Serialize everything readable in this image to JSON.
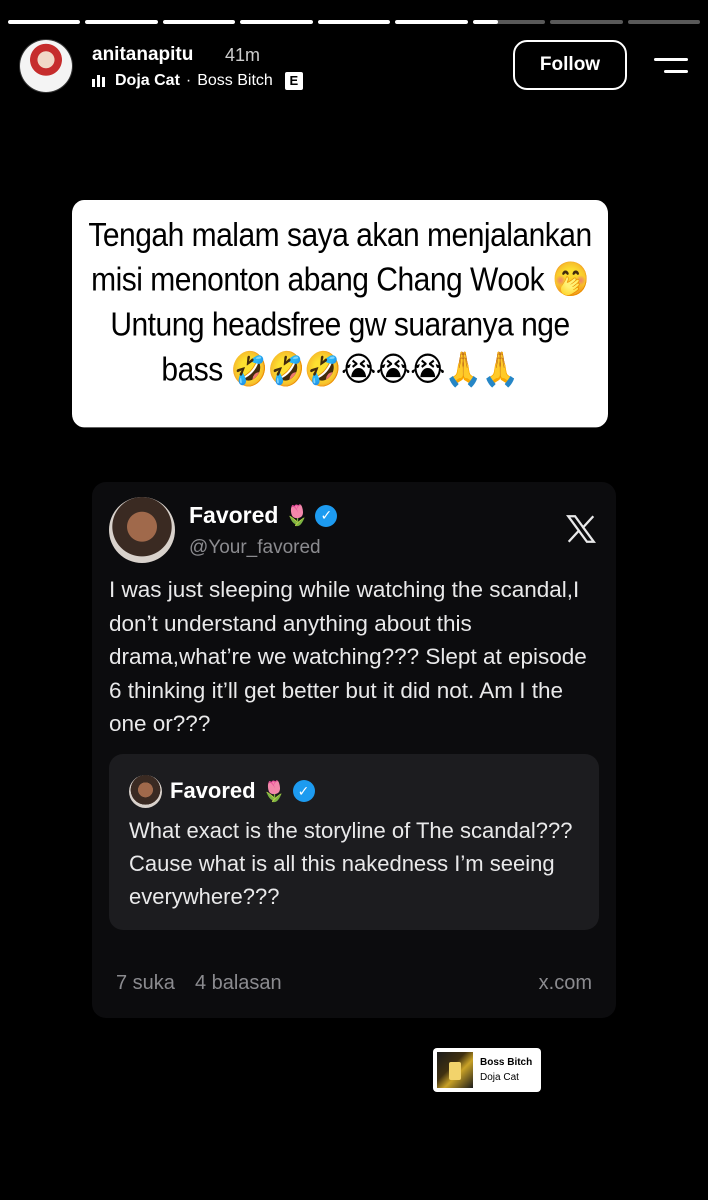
{
  "story": {
    "progress": {
      "segments": 9,
      "completed": 6,
      "current_fraction": 0.35
    }
  },
  "header": {
    "username": "anitanapitu",
    "time": "41m",
    "music": {
      "artist": "Doja Cat",
      "separator": "·",
      "title": "Boss Bitch",
      "explicit_badge": "E"
    },
    "follow_label": "Follow",
    "menu_icon": "menu-icon"
  },
  "caption": {
    "line1": "Tengah malam saya akan menjalankan",
    "line2": "misi menonton abang Chang Wook 🤭",
    "line3": "Untung headsfree gw suaranya nge",
    "line4": "bass 🤣🤣🤣😭😭😭🙏🙏"
  },
  "tweet": {
    "name": "Favored",
    "name_emoji": "🌷",
    "handle": "@Your_favored",
    "platform_icon": "x-logo-icon",
    "text": "I was just sleeping while watching the scandal,I don’t understand anything about this drama,what’re we watching??? Slept at episode 6 thinking it’ll get better but it did not. Am I the one or???",
    "quote": {
      "name": "Favored",
      "name_emoji": "🌷",
      "text": "What exact is the storyline of The scandal??? Cause what is all this nakedness I’m seeing everywhere???"
    },
    "footer": {
      "likes": "7 suka",
      "replies": "4 balasan",
      "domain": "x.com"
    },
    "colors": {
      "verified": "#1d9bf0",
      "card_bg": "#0c0c0e",
      "quote_bg": "#1c1c1f"
    }
  },
  "music_sticker": {
    "title": "Boss Bitch",
    "artist": "Doja Cat"
  }
}
